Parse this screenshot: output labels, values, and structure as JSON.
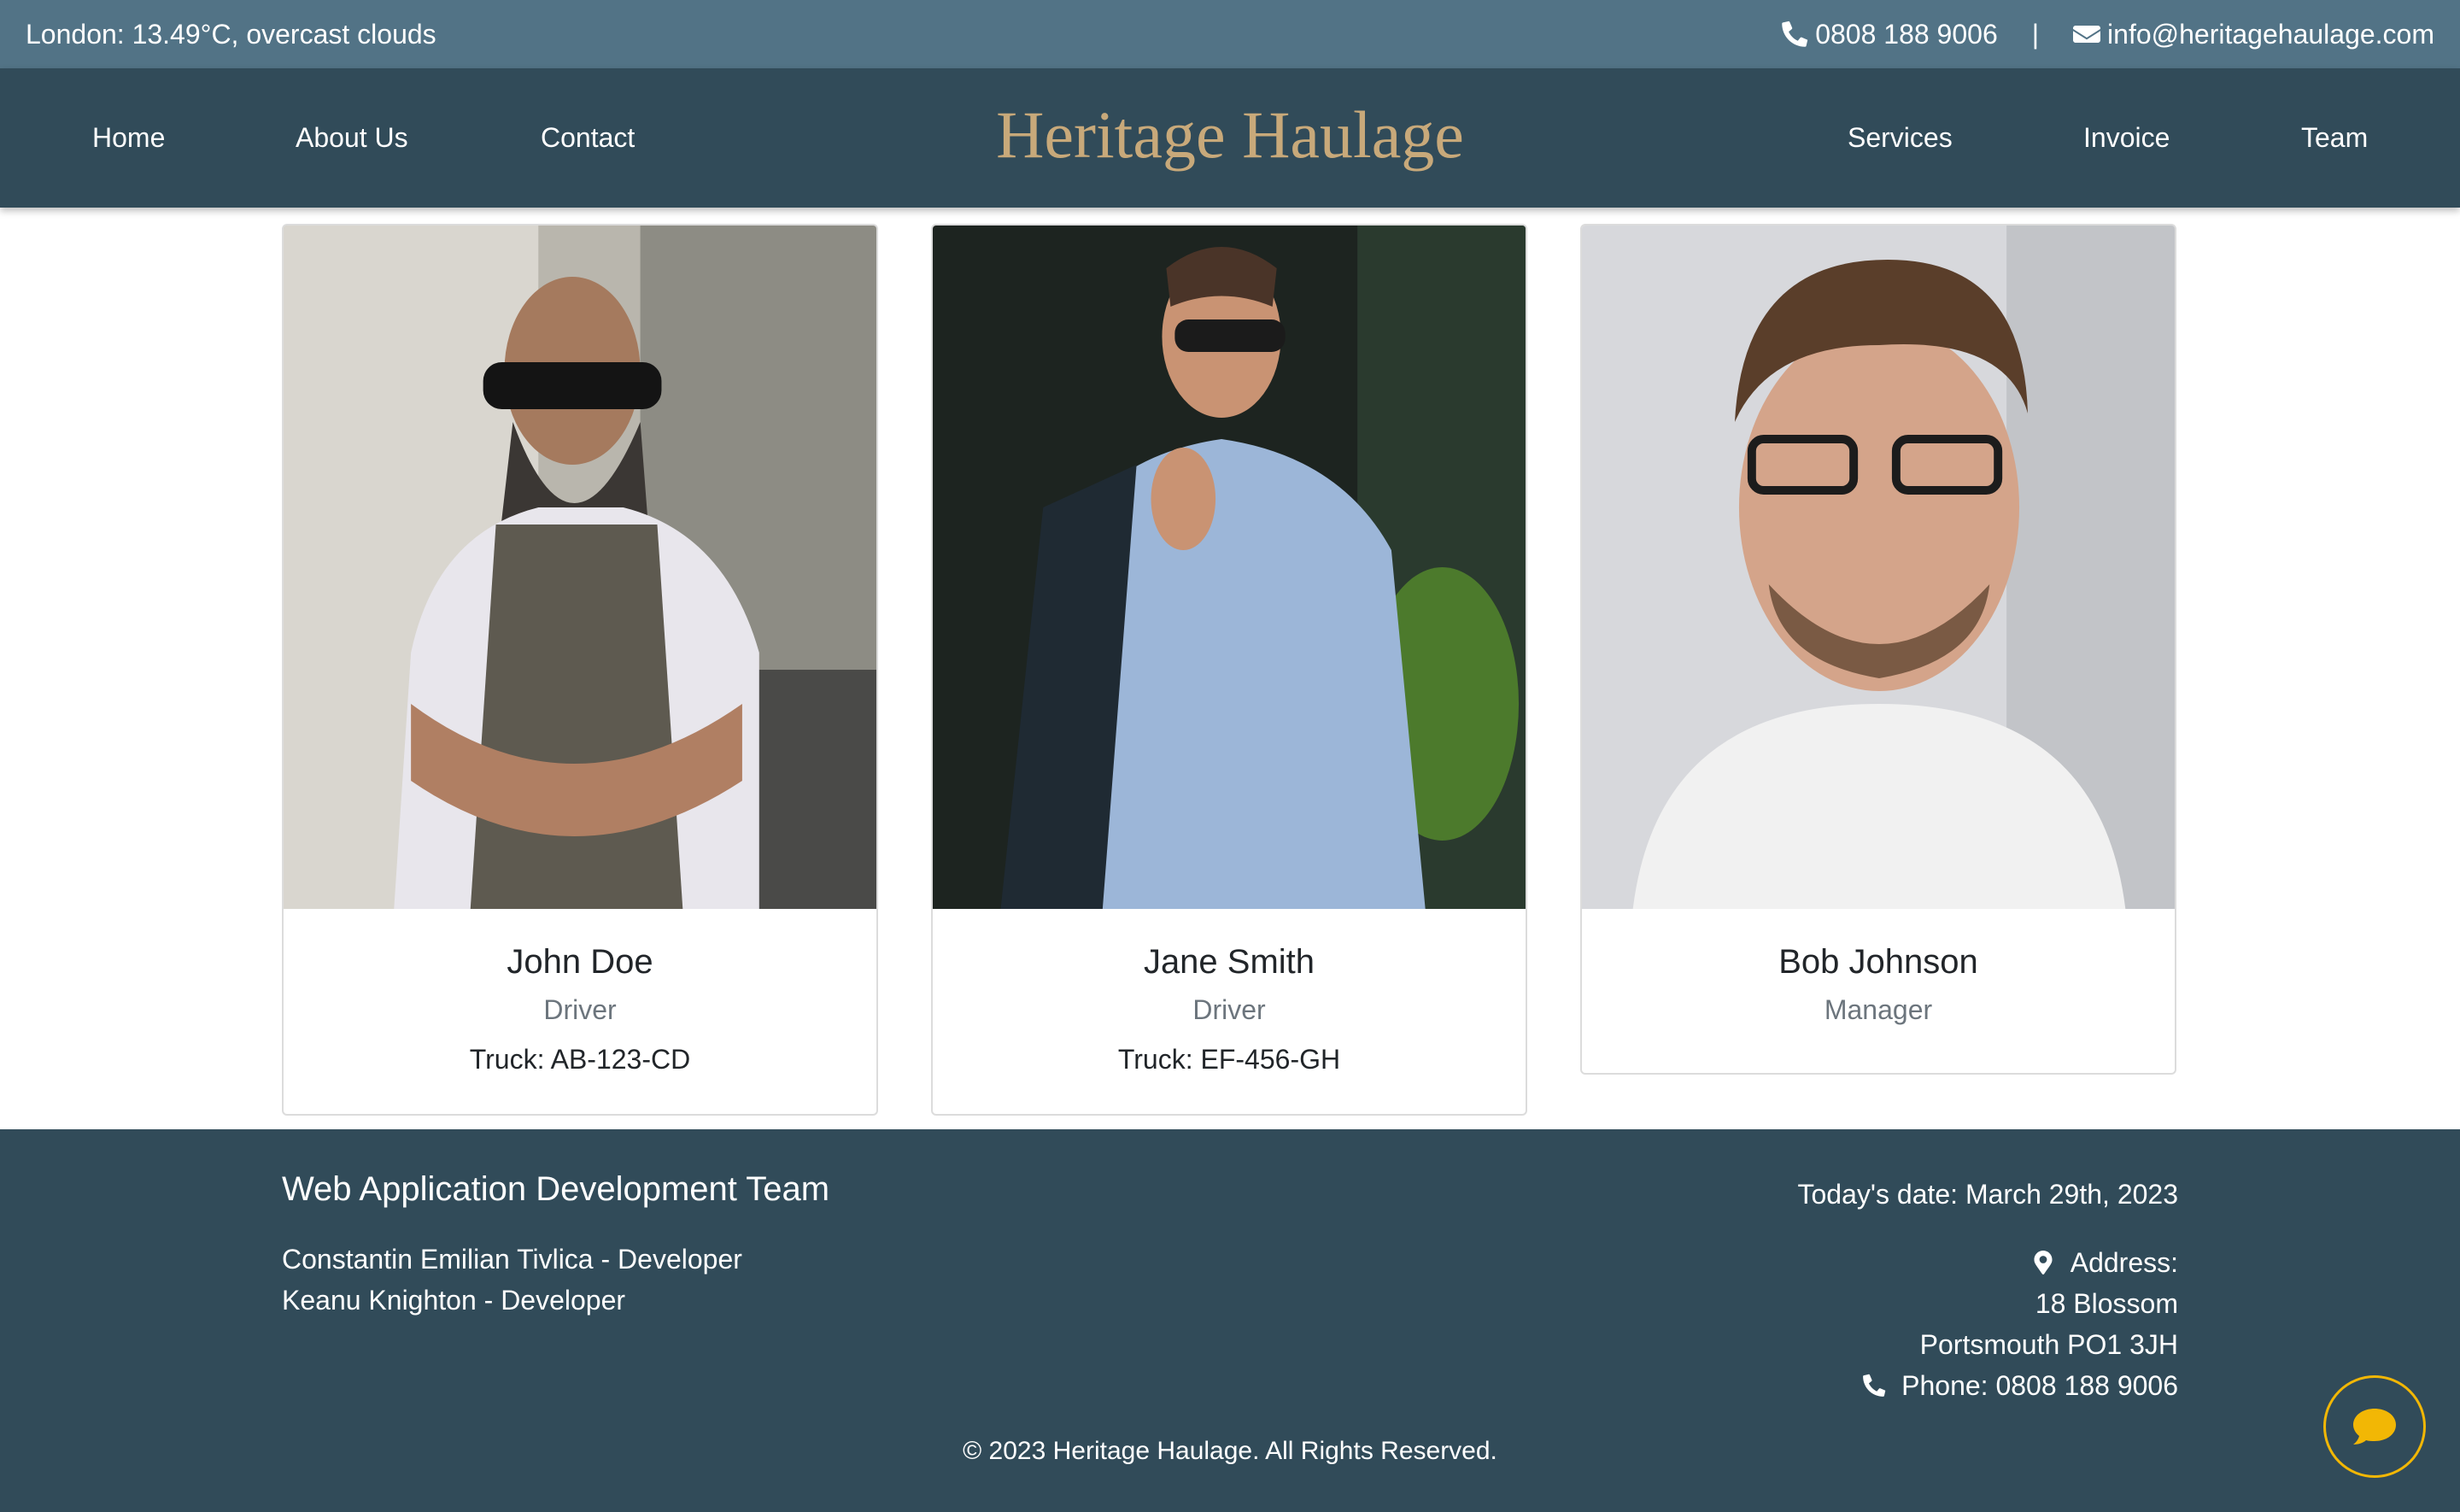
{
  "topbar": {
    "weather": "London: 13.49°C, overcast clouds",
    "phone": "0808 188 9006",
    "separator": "|",
    "email": "info@heritagehaulage.com"
  },
  "nav": {
    "brand": "Heritage Haulage",
    "links": [
      "Home",
      "About Us",
      "Contact",
      "Services",
      "Invoice",
      "Team"
    ]
  },
  "team": [
    {
      "name": "John Doe",
      "role": "Driver",
      "truck": "Truck: AB-123-CD"
    },
    {
      "name": "Jane Smith",
      "role": "Driver",
      "truck": "Truck: EF-456-GH"
    },
    {
      "name": "Bob Johnson",
      "role": "Manager"
    }
  ],
  "footer": {
    "title": "Web Application Development Team",
    "members": [
      "Constantin Emilian Tivlica - Developer",
      "Keanu Knighton - Developer"
    ],
    "date": "Today's date: March 29th, 2023",
    "address_label": "Address:",
    "address_lines": [
      "18 Blossom",
      "Portsmouth PO1 3JH"
    ],
    "phone": "Phone: 0808 188 9006",
    "copyright": "© 2023 Heritage Haulage. All Rights Reserved."
  },
  "colors": {
    "topbar": "#527386",
    "navbar": "#314b59",
    "brand": "#c8a97a",
    "footer": "#314b59",
    "chat_accent": "#f2b705"
  },
  "icons": {
    "phone": "phone-icon",
    "email": "envelope-icon",
    "address": "map-marker-icon",
    "chat": "chat-bubble-icon"
  }
}
